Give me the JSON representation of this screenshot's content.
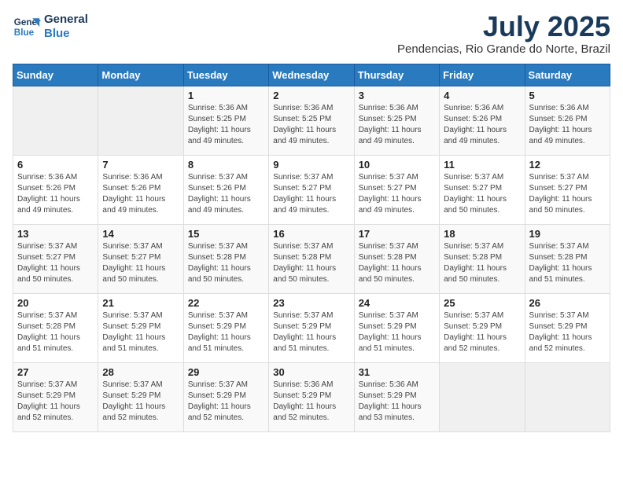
{
  "logo": {
    "line1": "General",
    "line2": "Blue"
  },
  "title": {
    "month_year": "July 2025",
    "location": "Pendencias, Rio Grande do Norte, Brazil"
  },
  "weekdays": [
    "Sunday",
    "Monday",
    "Tuesday",
    "Wednesday",
    "Thursday",
    "Friday",
    "Saturday"
  ],
  "weeks": [
    [
      {
        "day": "",
        "info": ""
      },
      {
        "day": "",
        "info": ""
      },
      {
        "day": "1",
        "info": "Sunrise: 5:36 AM\nSunset: 5:25 PM\nDaylight: 11 hours and 49 minutes."
      },
      {
        "day": "2",
        "info": "Sunrise: 5:36 AM\nSunset: 5:25 PM\nDaylight: 11 hours and 49 minutes."
      },
      {
        "day": "3",
        "info": "Sunrise: 5:36 AM\nSunset: 5:25 PM\nDaylight: 11 hours and 49 minutes."
      },
      {
        "day": "4",
        "info": "Sunrise: 5:36 AM\nSunset: 5:26 PM\nDaylight: 11 hours and 49 minutes."
      },
      {
        "day": "5",
        "info": "Sunrise: 5:36 AM\nSunset: 5:26 PM\nDaylight: 11 hours and 49 minutes."
      }
    ],
    [
      {
        "day": "6",
        "info": "Sunrise: 5:36 AM\nSunset: 5:26 PM\nDaylight: 11 hours and 49 minutes."
      },
      {
        "day": "7",
        "info": "Sunrise: 5:36 AM\nSunset: 5:26 PM\nDaylight: 11 hours and 49 minutes."
      },
      {
        "day": "8",
        "info": "Sunrise: 5:37 AM\nSunset: 5:26 PM\nDaylight: 11 hours and 49 minutes."
      },
      {
        "day": "9",
        "info": "Sunrise: 5:37 AM\nSunset: 5:27 PM\nDaylight: 11 hours and 49 minutes."
      },
      {
        "day": "10",
        "info": "Sunrise: 5:37 AM\nSunset: 5:27 PM\nDaylight: 11 hours and 49 minutes."
      },
      {
        "day": "11",
        "info": "Sunrise: 5:37 AM\nSunset: 5:27 PM\nDaylight: 11 hours and 50 minutes."
      },
      {
        "day": "12",
        "info": "Sunrise: 5:37 AM\nSunset: 5:27 PM\nDaylight: 11 hours and 50 minutes."
      }
    ],
    [
      {
        "day": "13",
        "info": "Sunrise: 5:37 AM\nSunset: 5:27 PM\nDaylight: 11 hours and 50 minutes."
      },
      {
        "day": "14",
        "info": "Sunrise: 5:37 AM\nSunset: 5:27 PM\nDaylight: 11 hours and 50 minutes."
      },
      {
        "day": "15",
        "info": "Sunrise: 5:37 AM\nSunset: 5:28 PM\nDaylight: 11 hours and 50 minutes."
      },
      {
        "day": "16",
        "info": "Sunrise: 5:37 AM\nSunset: 5:28 PM\nDaylight: 11 hours and 50 minutes."
      },
      {
        "day": "17",
        "info": "Sunrise: 5:37 AM\nSunset: 5:28 PM\nDaylight: 11 hours and 50 minutes."
      },
      {
        "day": "18",
        "info": "Sunrise: 5:37 AM\nSunset: 5:28 PM\nDaylight: 11 hours and 50 minutes."
      },
      {
        "day": "19",
        "info": "Sunrise: 5:37 AM\nSunset: 5:28 PM\nDaylight: 11 hours and 51 minutes."
      }
    ],
    [
      {
        "day": "20",
        "info": "Sunrise: 5:37 AM\nSunset: 5:28 PM\nDaylight: 11 hours and 51 minutes."
      },
      {
        "day": "21",
        "info": "Sunrise: 5:37 AM\nSunset: 5:29 PM\nDaylight: 11 hours and 51 minutes."
      },
      {
        "day": "22",
        "info": "Sunrise: 5:37 AM\nSunset: 5:29 PM\nDaylight: 11 hours and 51 minutes."
      },
      {
        "day": "23",
        "info": "Sunrise: 5:37 AM\nSunset: 5:29 PM\nDaylight: 11 hours and 51 minutes."
      },
      {
        "day": "24",
        "info": "Sunrise: 5:37 AM\nSunset: 5:29 PM\nDaylight: 11 hours and 51 minutes."
      },
      {
        "day": "25",
        "info": "Sunrise: 5:37 AM\nSunset: 5:29 PM\nDaylight: 11 hours and 52 minutes."
      },
      {
        "day": "26",
        "info": "Sunrise: 5:37 AM\nSunset: 5:29 PM\nDaylight: 11 hours and 52 minutes."
      }
    ],
    [
      {
        "day": "27",
        "info": "Sunrise: 5:37 AM\nSunset: 5:29 PM\nDaylight: 11 hours and 52 minutes."
      },
      {
        "day": "28",
        "info": "Sunrise: 5:37 AM\nSunset: 5:29 PM\nDaylight: 11 hours and 52 minutes."
      },
      {
        "day": "29",
        "info": "Sunrise: 5:37 AM\nSunset: 5:29 PM\nDaylight: 11 hours and 52 minutes."
      },
      {
        "day": "30",
        "info": "Sunrise: 5:36 AM\nSunset: 5:29 PM\nDaylight: 11 hours and 52 minutes."
      },
      {
        "day": "31",
        "info": "Sunrise: 5:36 AM\nSunset: 5:29 PM\nDaylight: 11 hours and 53 minutes."
      },
      {
        "day": "",
        "info": ""
      },
      {
        "day": "",
        "info": ""
      }
    ]
  ]
}
